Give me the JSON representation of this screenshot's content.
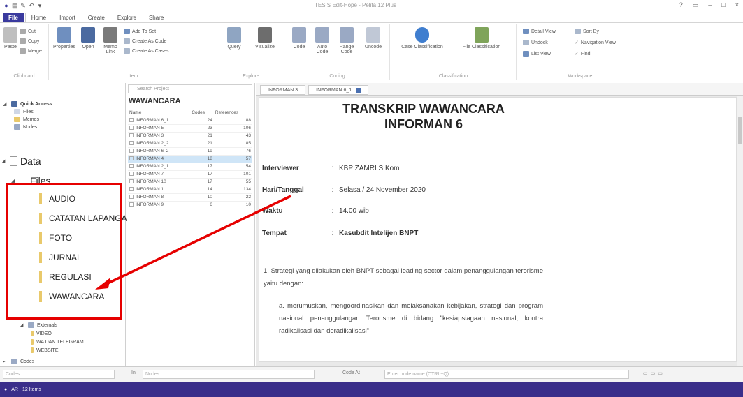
{
  "window": {
    "title": "TESIS Edit-Hope - Pelita 12 Plus",
    "controls": [
      "?",
      "▭",
      "–",
      "□",
      "×"
    ]
  },
  "ribbon_tabs": [
    "File",
    "Home",
    "Import",
    "Create",
    "Explore",
    "Share"
  ],
  "ribbon": {
    "paste": "Paste",
    "cut": "Cut",
    "copy": "Copy",
    "merge": "Merge",
    "clipboard": "Clipboard",
    "properties": "Properties",
    "open": "Open",
    "memo": "Memo Link",
    "link_set": "Add To Set",
    "create_as_code": "Create As Code",
    "create_as_cases": "Create As Cases",
    "item": "Item",
    "query": "Query",
    "visualize": "Visualize",
    "explore": "Explore",
    "code": "Code",
    "auto_code": "Auto Code",
    "range_code": "Range Code",
    "uncode": "Uncode",
    "coding": "Coding",
    "case_classification": "Case Classification",
    "file_classification": "File Classification",
    "classification": "Classification",
    "detail_view": "Detail View",
    "sort_by": "Sort By",
    "undock": "Undock",
    "list_view": "List View",
    "navigation_view": "Navigation View",
    "find": "Find",
    "workspace": "Workspace"
  },
  "nav": {
    "quick_access": "Quick Access",
    "qa_files": "Files",
    "qa_memos": "Memos",
    "qa_nodes": "Nodes",
    "data": "Data",
    "files": "Files",
    "folders": [
      "AUDIO",
      "CATATAN LAPANGA",
      "FOTO",
      "JURNAL",
      "REGULASI",
      "WAWANCARA"
    ],
    "externals": "Externals",
    "ext_items": [
      "VIDEO",
      "WA DAN TELEGRAM",
      "WEBSITE"
    ],
    "codes": "Codes"
  },
  "list": {
    "search_placeholder": "Search Project",
    "title": "WAWANCARA",
    "col_name": "Name",
    "col_codes": "Codes",
    "col_refs": "References",
    "rows": [
      {
        "name": "INFORMAN 6_1",
        "codes": "24",
        "refs": "88"
      },
      {
        "name": "INFORMAN 5",
        "codes": "23",
        "refs": "106"
      },
      {
        "name": "INFORMAN 3",
        "codes": "21",
        "refs": "43"
      },
      {
        "name": "INFORMAN 2_2",
        "codes": "21",
        "refs": "85"
      },
      {
        "name": "INFORMAN 6_2",
        "codes": "19",
        "refs": "76"
      },
      {
        "name": "INFORMAN 4",
        "codes": "18",
        "refs": "57"
      },
      {
        "name": "INFORMAN 2_1",
        "codes": "17",
        "refs": "54"
      },
      {
        "name": "INFORMAN 7",
        "codes": "17",
        "refs": "101"
      },
      {
        "name": "INFORMAN 10",
        "codes": "17",
        "refs": "55"
      },
      {
        "name": "INFORMAN 1",
        "codes": "14",
        "refs": "134"
      },
      {
        "name": "INFORMAN 8",
        "codes": "10",
        "refs": "22"
      },
      {
        "name": "INFORMAN 9",
        "codes": "6",
        "refs": "10"
      }
    ]
  },
  "doc": {
    "tabs": [
      "INFORMAN 3",
      "INFORMAN 6_1"
    ],
    "title1": "TRANSKRIP WAWANCARA",
    "title2": "INFORMAN 6",
    "fields": [
      {
        "k": "Interviewer",
        "v": "KBP ZAMRI S.Kom"
      },
      {
        "k": "Hari/Tanggal",
        "v": "Selasa / 24 November 2020"
      },
      {
        "k": "Waktu",
        "v": "14.00 wib"
      },
      {
        "k": "Tempat",
        "v": "Kasubdit Intelijen BNPT"
      }
    ],
    "colon": ":",
    "p1": "1.  Strategi yang dilakukan oleh BNPT sebagai leading sector dalam penanggulangan terorisme yaitu dengan:",
    "p2": "a.  merumuskan, mengoordinasikan dan melaksanakan kebijakan, strategi dan program nasional penanggulangan Terorisme di bidang \"kesiapsiagaan nasional, kontra radikalisasi dan deradikalisasi\""
  },
  "bottom": {
    "in": "In",
    "nodes": "Nodes",
    "code_at": "Code At",
    "code_at_placeholder": "Enter node name (CTRL+Q)"
  },
  "status": {
    "user": "AR",
    "items": "12 Items"
  },
  "colors": {
    "file_tab": "#3a3a9e",
    "status_bar": "#3a2e8a",
    "annotation": "#e60000",
    "selection": "#cfe5f7",
    "folder": "#e9c96b"
  }
}
